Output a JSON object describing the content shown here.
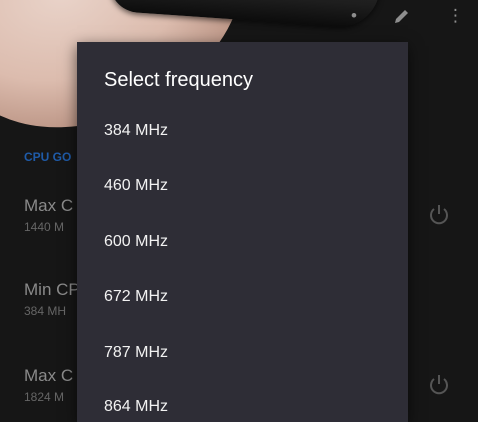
{
  "dialog": {
    "title": "Select frequency",
    "options": [
      "384 MHz",
      "460 MHz",
      "600 MHz",
      "672 MHz",
      "787 MHz",
      "864 MHz"
    ]
  },
  "background": {
    "section_header": "CPU GO",
    "items": [
      {
        "title": "Max C",
        "value": "1440 M"
      },
      {
        "title": "Min CP",
        "value": "384 MH"
      },
      {
        "title": "Max C",
        "value": "1824 M"
      }
    ]
  },
  "colors": {
    "dialog_bg": "#2e2d36",
    "screen_bg": "#161616",
    "accent": "#1f5ba8"
  }
}
